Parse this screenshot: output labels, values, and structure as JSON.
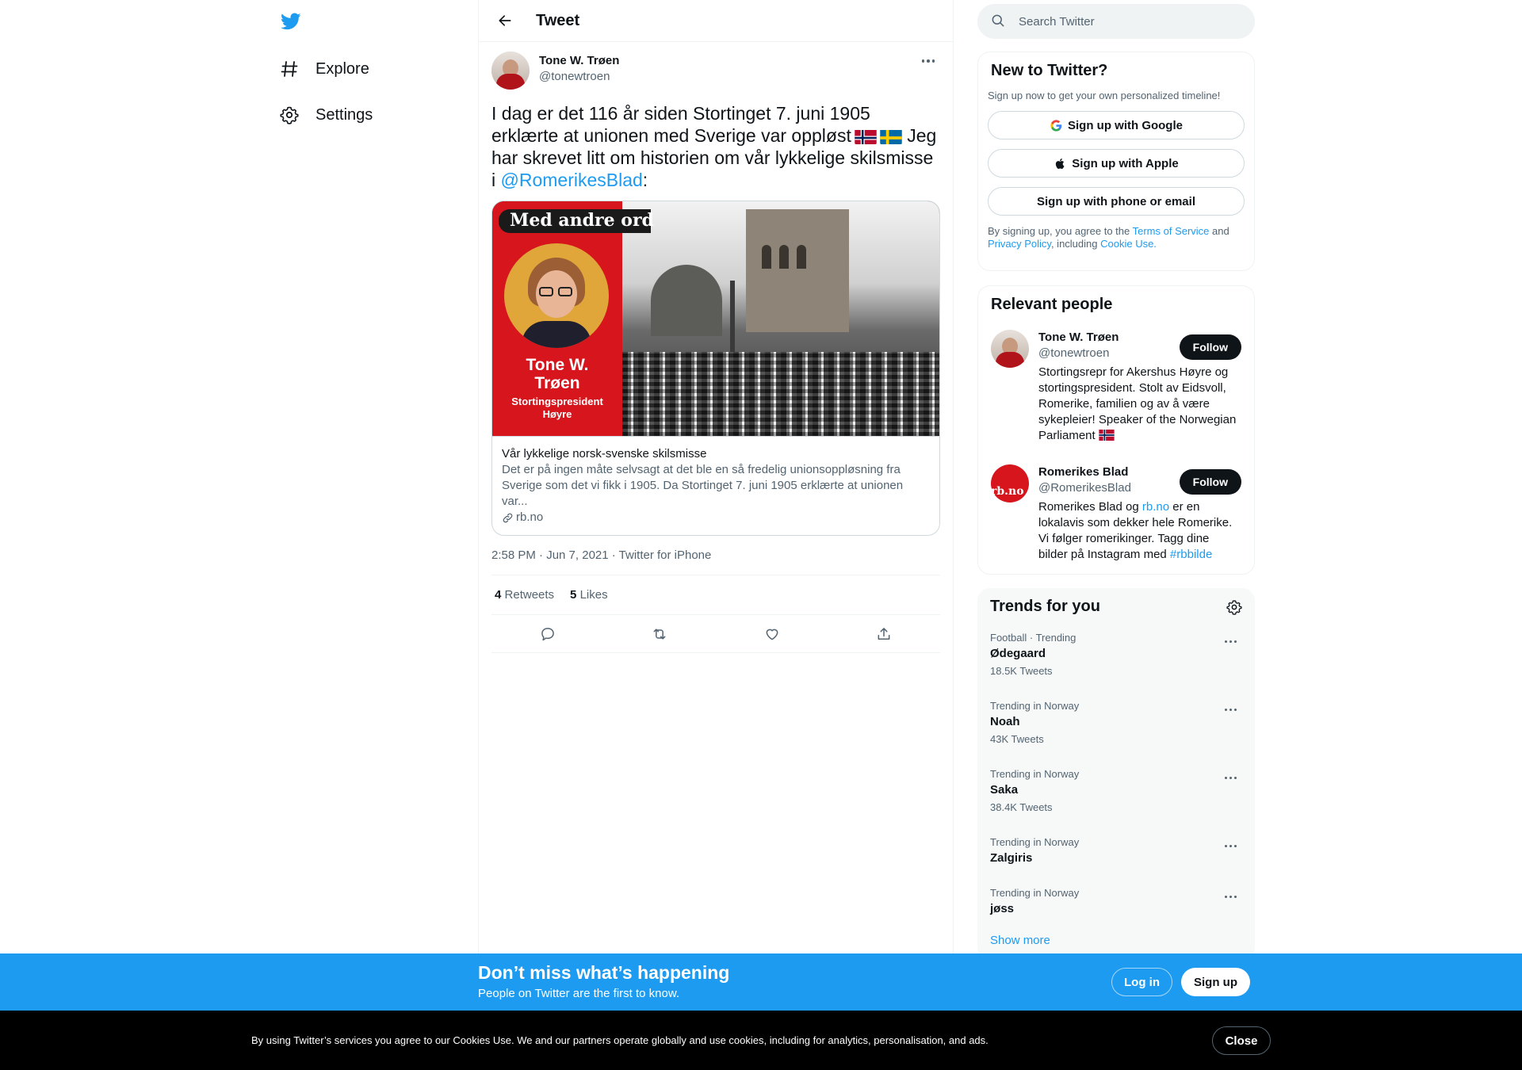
{
  "nav": {
    "logo_icon": "twitter-bird-icon",
    "items": [
      {
        "label": "Explore",
        "icon": "hashtag-icon"
      },
      {
        "label": "Settings",
        "icon": "gear-icon"
      }
    ]
  },
  "header": {
    "title": "Tweet",
    "back_icon": "arrow-left-icon"
  },
  "tweet": {
    "author_name": "Tone W. Trøen",
    "author_handle": "@tonewtroen",
    "text_part1": "I dag er det 116 år siden Stortinget 7. juni 1905 erklærte at unionen med Sverige var oppløst",
    "text_part2": " Jeg har skrevet litt om historien om vår lykkelige skilsmisse i ",
    "mention": "@RomerikesBlad",
    "text_end": ":",
    "flags": [
      "norway-flag",
      "sweden-flag"
    ],
    "card": {
      "image_banner": "Med andre ord",
      "image_name": "Tone W. Trøen",
      "image_role": "Stortingspresident",
      "image_party": "Høyre",
      "title": "Vår lykkelige norsk-svenske skilsmisse",
      "description": "Det er på ingen måte selvsagt at det ble en så fredelig unionsoppløsning fra Sverige som det vi fikk i 1905.  Da Stortinget 7. juni 1905 erklærte at unionen var...",
      "domain": "rb.no"
    },
    "timestamp": "2:58 PM · Jun 7, 2021 · Twitter for iPhone",
    "retweets_count": "4",
    "retweets_label": "Retweets",
    "likes_count": "5",
    "likes_label": "Likes",
    "action_icons": [
      "reply-icon",
      "retweet-icon",
      "like-icon",
      "share-icon"
    ]
  },
  "search": {
    "placeholder": "Search Twitter"
  },
  "new_to_twitter": {
    "title": "New to Twitter?",
    "subtitle": "Sign up now to get your own personalized timeline!",
    "google_label": "Sign up with Google",
    "apple_label": "Sign up with Apple",
    "phone_label": "Sign up with phone or email",
    "legal_1": "By signing up, you agree to the ",
    "terms": "Terms of Service",
    "legal_2": " and ",
    "privacy": "Privacy Policy",
    "legal_3": ", including ",
    "cookie": "Cookie Use."
  },
  "relevant_people": {
    "title": "Relevant people",
    "people": [
      {
        "name": "Tone W. Trøen",
        "handle": "@tonewtroen",
        "follow": "Follow",
        "bio": "Stortingsrepr for Akershus Høyre og stortingspresident. Stolt av Eidsvoll, Romerike, familien og av å være sykepleier! Speaker of the Norwegian Parliament"
      },
      {
        "name": "Romerikes Blad",
        "handle": "@RomerikesBlad",
        "follow": "Follow",
        "bio_1": "Romerikes Blad og ",
        "bio_link": "rb.no",
        "bio_2": " er en lokalavis som dekker hele Romerike. Vi følger romerikinger. Tagg dine bilder på Instagram med ",
        "bio_tag": "#rbbilde",
        "avatar_text": "rb.no"
      }
    ]
  },
  "trends": {
    "title": "Trends for you",
    "items": [
      {
        "context": "Football · Trending",
        "name": "Ødegaard",
        "count": "18.5K Tweets"
      },
      {
        "context": "Trending in Norway",
        "name": "Noah",
        "count": "43K Tweets"
      },
      {
        "context": "Trending in Norway",
        "name": "Saka",
        "count": "38.4K Tweets"
      },
      {
        "context": "Trending in Norway",
        "name": "Zalgiris",
        "count": ""
      },
      {
        "context": "Trending in Norway",
        "name": "jøss",
        "count": ""
      }
    ],
    "show_more": "Show more"
  },
  "banner": {
    "title": "Don’t miss what’s happening",
    "subtitle": "People on Twitter are the first to know.",
    "login": "Log in",
    "signup": "Sign up"
  },
  "cookie_bar": {
    "text": "By using Twitter’s services you agree to our Cookies Use. We and our partners operate globally and use cookies, including for analytics, personalisation, and ads.",
    "close": "Close"
  },
  "colors": {
    "accent": "#1d9bf0",
    "text": "#0f1419",
    "secondary": "#536471",
    "card_red": "#d6151d"
  }
}
